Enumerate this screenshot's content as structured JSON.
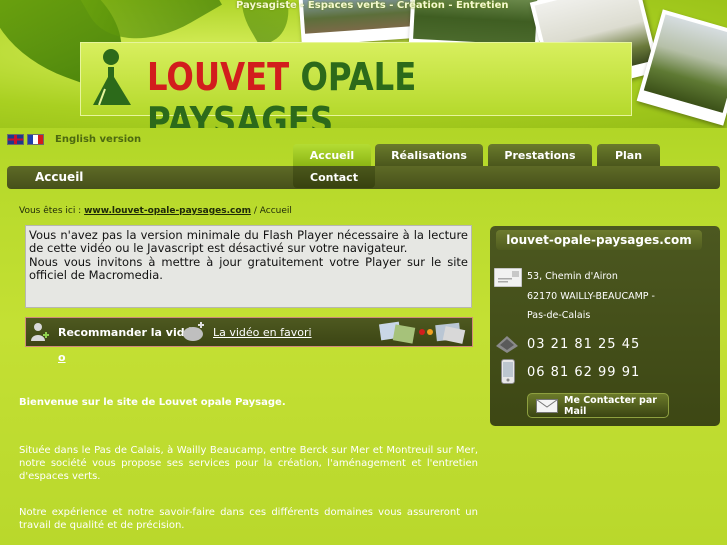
{
  "header": {
    "tagline": "Paysagiste - Espaces verts - Création - Entretien",
    "logo_word1": "LOUVET",
    "logo_word2": "OPALE PAYSAGES"
  },
  "language": {
    "english_link": "English version"
  },
  "nav": {
    "current_title": "Accueil",
    "tabs": [
      {
        "label": "Accueil",
        "active": true
      },
      {
        "label": "Réalisations",
        "active": false
      },
      {
        "label": "Prestations",
        "active": false
      },
      {
        "label": "Plan",
        "active": false
      }
    ],
    "sub_tab": "Contact"
  },
  "breadcrumb": {
    "prefix": "Vous êtes ici :",
    "link": "www.louvet-opale-paysages.com",
    "separator": "/",
    "current": "Accueil"
  },
  "flash_notice": {
    "line1": "Vous n'avez pas la version minimale du Flash Player nécessaire à la lecture de cette vidéo ou le Javascript est désactivé sur votre navigateur.",
    "line2": "Nous vous invitons à mettre à jour gratuitement votre Player sur le site officiel de Macromedia."
  },
  "video_bar": {
    "recommend": "Recommander la vidé",
    "recommend_overflow": "o",
    "favorite": "La vidéo en favori"
  },
  "content": {
    "welcome": "Bienvenue sur le site de Louvet opale Paysage.",
    "para1": "Située dans le Pas de Calais, à Wailly Beaucamp, entre Berck sur Mer et Montreuil sur Mer, notre société vous propose ses services pour la création, l'aménagement et l'entretien d'espaces verts.",
    "para2": "Notre expérience et notre savoir-faire dans ces différents domaines vous assureront un travail de qualité et de précision."
  },
  "contact_panel": {
    "title": "louvet-opale-paysages.com",
    "address_line1": "53, Chemin d'Airon",
    "address_line2": "62170 WAILLY-BEAUCAMP -",
    "address_line3": "Pas-de-Calais",
    "phone": "03 21 81 25 45",
    "mobile": "06 81 62 99 91",
    "mail_button": "Me Contacter par Mail"
  },
  "colors": {
    "background": "#b6d92a",
    "nav_dark": "#46501a",
    "tab_active": "#9ec624",
    "logo_red": "#d21d1d",
    "logo_green": "#2c6a1a"
  }
}
